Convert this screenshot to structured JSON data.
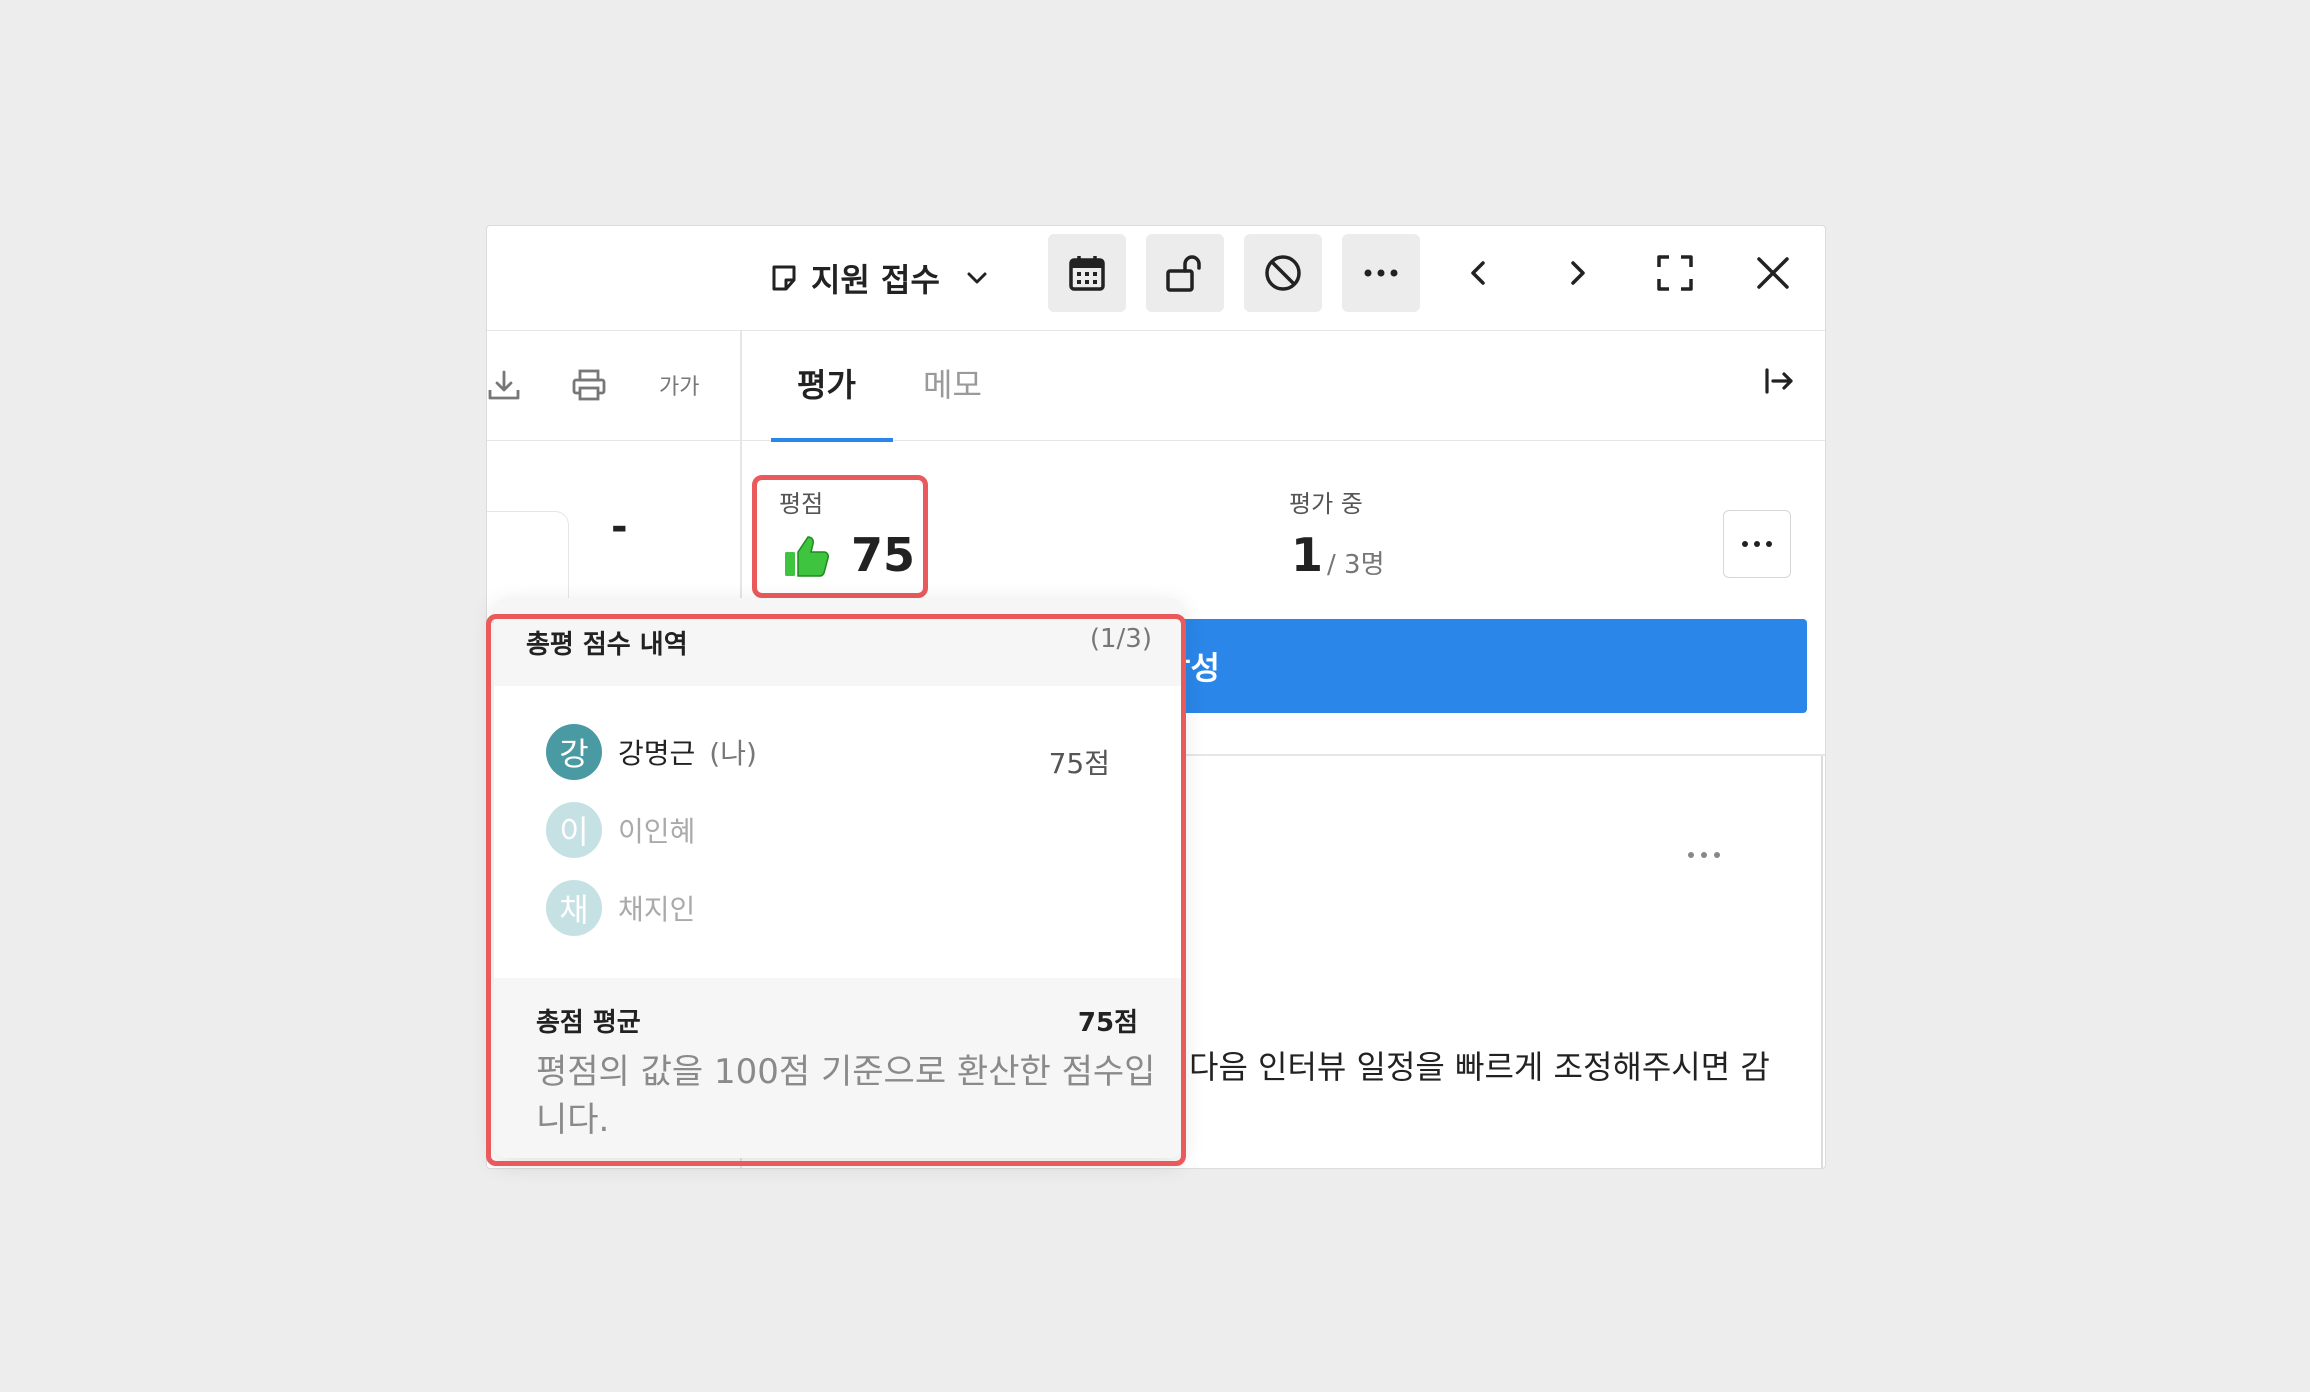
{
  "header": {
    "stage_label": "지원 접수",
    "buttons": [
      "calendar-icon",
      "unlock-icon",
      "block-icon",
      "more-icon",
      "chevron-left-icon",
      "chevron-right-icon",
      "fullscreen-icon",
      "close-icon"
    ]
  },
  "left_toolbar": {
    "font_size_label": "가가"
  },
  "left_panel": {
    "dash": "-"
  },
  "tabs": [
    {
      "label": "평가",
      "active": true
    },
    {
      "label": "메모",
      "active": false
    }
  ],
  "score": {
    "label": "평점",
    "value": "75",
    "icon": "thumbs-up-icon",
    "icon_color": "#3ec43e"
  },
  "progress": {
    "label": "평가 중",
    "count": "1",
    "total": "/ 3명"
  },
  "write_button_label": "평가 작성",
  "comment_text": "다음 인터뷰 일정을 빠르게 조정해주시면 감",
  "popover": {
    "title": "총평 점수 내역",
    "count": "(1/3)",
    "people": [
      {
        "initial": "강",
        "name": "강명근",
        "me": "(나)",
        "score": "75점",
        "color": "#4a9aa3",
        "active": true
      },
      {
        "initial": "이",
        "name": "이인혜",
        "me": "",
        "score": "",
        "color": "#c5e1e4",
        "active": false
      },
      {
        "initial": "채",
        "name": "채지인",
        "me": "",
        "score": "",
        "color": "#c5e1e4",
        "active": false
      }
    ],
    "average_label": "총점 평균",
    "average_value": "75점",
    "average_desc": "평점의 값을 100점 기준으로 환산한 점수입니다."
  },
  "colors": {
    "accent": "#2a86e8",
    "highlight": "#ea5a5d",
    "background": "#ededed"
  }
}
